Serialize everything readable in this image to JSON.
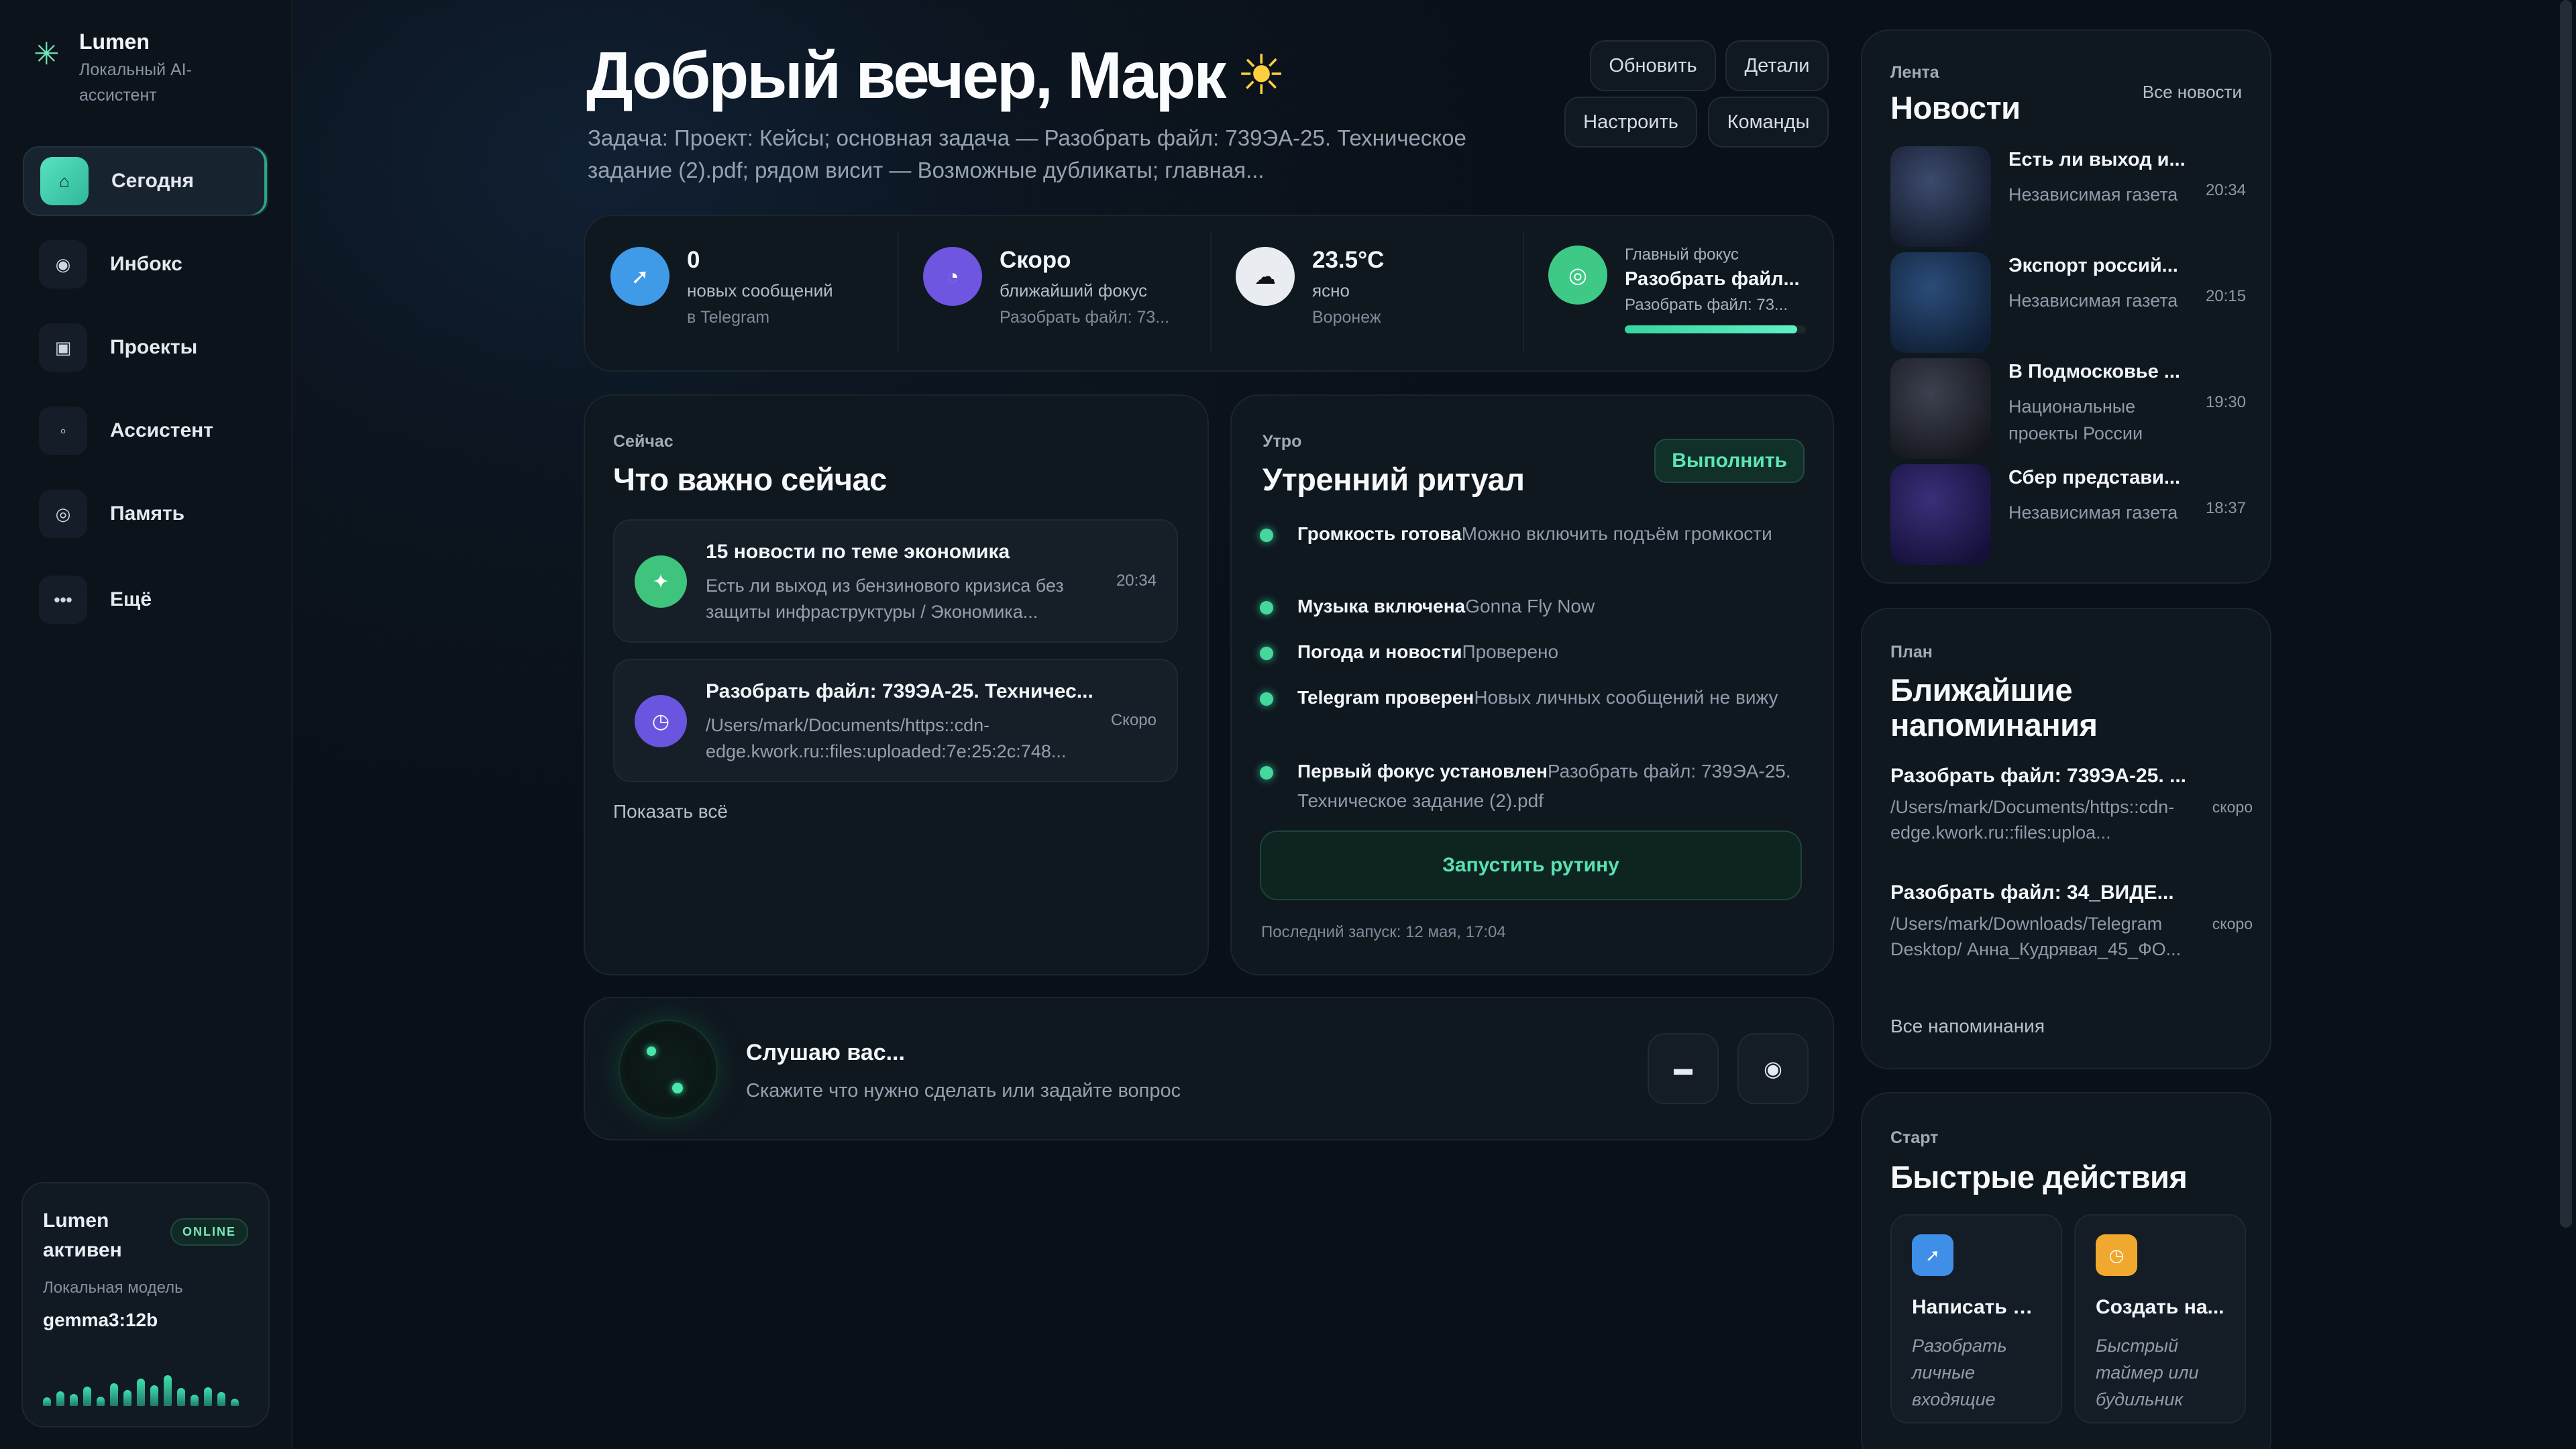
{
  "brand": {
    "name": "Lumen",
    "subtitle": "Локальный AI-ассистент"
  },
  "nav": [
    {
      "label": "Сегодня",
      "icon": "home-icon",
      "glyph": "⌂",
      "active": true
    },
    {
      "label": "Инбокс",
      "icon": "inbox-icon",
      "glyph": "◉"
    },
    {
      "label": "Проекты",
      "icon": "projects-icon",
      "glyph": "▣"
    },
    {
      "label": "Ассистент",
      "icon": "assistant-icon",
      "glyph": "◦"
    },
    {
      "label": "Память",
      "icon": "memory-icon",
      "glyph": "◎"
    },
    {
      "label": "Ещё",
      "icon": "more-icon",
      "glyph": "•••"
    }
  ],
  "status": {
    "title": "Lumen активен",
    "badge": "ONLINE",
    "model_label": "Локальная модель",
    "model": "gemma3:12b",
    "levels": [
      0.18,
      0.32,
      0.26,
      0.42,
      0.2,
      0.48,
      0.34,
      0.58,
      0.44,
      0.66,
      0.38,
      0.24,
      0.4,
      0.3,
      0.16
    ]
  },
  "header": {
    "greeting": "Добрый вечер, Марк",
    "task": "Задача: Проект: Кейсы; основная задача — Разобрать файл: 739ЭА-25. Техническое задание (2).pdf; рядом висит — Возможные дубликаты; главная...",
    "buttons": {
      "refresh": "Обновить",
      "details": "Детали",
      "configure": "Настроить",
      "commands": "Команды"
    }
  },
  "stats": [
    {
      "value": "0",
      "label": "новых сообщений",
      "sub": "в Telegram",
      "icon": "telegram-icon",
      "glyph": "➚",
      "color": "#3f9be8"
    },
    {
      "value": "Скоро",
      "label": "ближайший фокус",
      "sub": "Разобрать файл: 73...",
      "icon": "clock-icon",
      "glyph": "◔",
      "color": "#6e56e0"
    },
    {
      "value": "23.5°C",
      "label": "ясно",
      "sub": "Воронеж",
      "icon": "cloud-icon",
      "glyph": "☁",
      "color": "#e9edf1"
    },
    {
      "caption": "Главный фокус",
      "value": "Разобрать файл...",
      "sub": "Разобрать файл: 73...",
      "icon": "focus-target-icon",
      "glyph": "◎",
      "color": "#3ec986",
      "progress": 0.95
    }
  ],
  "now": {
    "eyebrow": "Сейчас",
    "title": "Что важно сейчас",
    "items": [
      {
        "title": "15 новости по теме экономика",
        "desc": "Есть ли выход из бензинового кризиса без защиты инфраструктуры / Экономика...",
        "time": "20:34",
        "icon": "sparkle-icon",
        "glyph": "✦",
        "color": "#3ec47c"
      },
      {
        "title": "Разобрать файл: 739ЭА-25. Техничес...",
        "desc": "/Users/mark/Documents/https::cdn-edge.kwork.ru::files:uploaded:7e:25:2c:748...",
        "time": "Скоро",
        "icon": "clock-icon",
        "glyph": "◷",
        "color": "#6a55e0"
      }
    ],
    "show_all": "Показать всё"
  },
  "ritual": {
    "eyebrow": "Утро",
    "title": "Утренний ритуал",
    "execute": "Выполнить",
    "items": [
      {
        "bold": "Громкость готова",
        "text": "Можно включить подъём громкости"
      },
      {
        "bold": "Музыка включена",
        "text": "Gonna Fly Now"
      },
      {
        "bold": "Погода и новости",
        "text": "Проверено"
      },
      {
        "bold": "Telegram проверен",
        "text": "Новых личных сообщений не вижу"
      },
      {
        "bold": "Первый фокус установлен",
        "text": "Разобрать файл: 739ЭА-25. Техническое задание (2).pdf"
      }
    ],
    "run": "Запустить рутину",
    "last_run": "Последний запуск: 12 мая, 17:04"
  },
  "voice": {
    "title": "Слушаю вас...",
    "hint": "Скажите что нужно сделать или задайте вопрос",
    "keyboard_icon": "keyboard-icon",
    "mic_icon": "record-icon"
  },
  "news": {
    "eyebrow": "Лента",
    "title": "Новости",
    "all": "Все новости",
    "items": [
      {
        "title": "Есть ли выход и...",
        "source": "Независимая газета",
        "time": "20:34",
        "c1": "#3c4a6e",
        "c2": "#101826"
      },
      {
        "title": "Экспорт россий...",
        "source": "Независимая газета",
        "time": "20:15",
        "c1": "#2a4c7a",
        "c2": "#0f1e33"
      },
      {
        "title": "В Подмосковье ...",
        "source": "Национальные проекты России",
        "time": "19:30",
        "c1": "#3d4150",
        "c2": "#14161c"
      },
      {
        "title": "Сбер представи...",
        "source": "Независимая газета",
        "time": "18:37",
        "c1": "#3a2f7a",
        "c2": "#141038"
      }
    ]
  },
  "reminders": {
    "eyebrow": "План",
    "title": "Ближайшие напоминания",
    "items": [
      {
        "title": "Разобрать файл: 739ЭА-25. ...",
        "desc": "/Users/mark/Documents/https::cdn-edge.kwork.ru::files:uploa...",
        "when": "скоро"
      },
      {
        "title": "Разобрать файл: 34_ВИДЕ...",
        "desc": "/Users/mark/Downloads/Telegram Desktop/ Анна_Кудрявая_45_ФО...",
        "when": "скоро"
      }
    ],
    "all": "Все напоминания"
  },
  "quick": {
    "eyebrow": "Старт",
    "title": "Быстрые действия",
    "items": [
      {
        "title": "Написать в...",
        "desc": "Разобрать личные входящие",
        "icon": "send-icon",
        "glyph": "➚",
        "color": "#3f8ee8"
      },
      {
        "title": "Создать на...",
        "desc": "Быстрый таймер или будильник",
        "icon": "timer-icon",
        "glyph": "◷",
        "color": "#f0a92e"
      }
    ]
  }
}
